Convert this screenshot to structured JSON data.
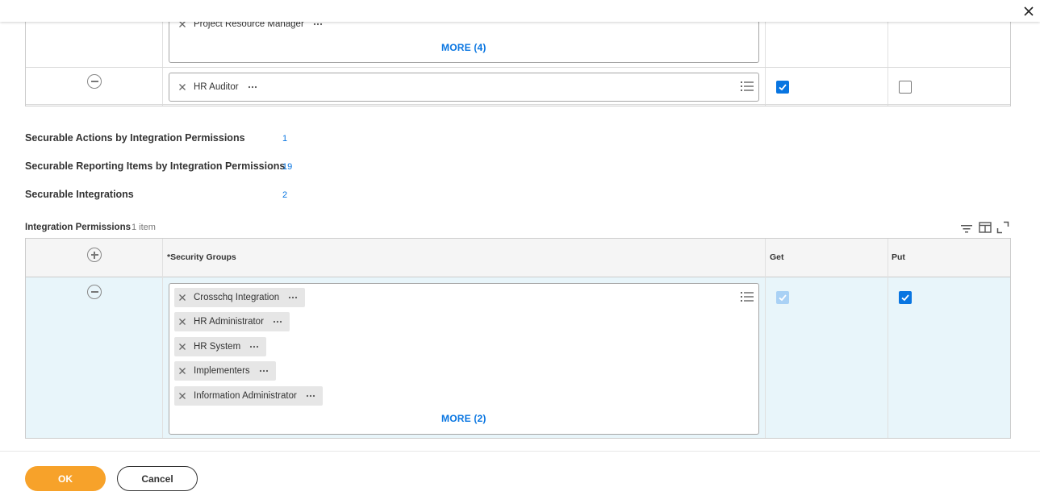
{
  "top_table": {
    "row1": {
      "pill": "Project Resource Manager",
      "more": "MORE (4)"
    },
    "row2": {
      "pill": "HR Auditor",
      "get_checked": true,
      "put_checked": false
    }
  },
  "fields": [
    {
      "label": "Securable Actions by Integration Permissions",
      "value": "1"
    },
    {
      "label": "Securable Reporting Items by Integration Permissions",
      "value": "19"
    },
    {
      "label": "Securable Integrations",
      "value": "2"
    }
  ],
  "integration_permissions": {
    "title": "Integration Permissions",
    "count": "1 item",
    "headers": {
      "security_groups": "*Security Groups",
      "get": "Get",
      "put": "Put"
    },
    "row": {
      "pills": [
        "Crosschq Integration",
        "HR Administrator",
        "HR System",
        "Implementers",
        "Information Administrator"
      ],
      "more": "MORE (2)",
      "get_checked": true,
      "get_disabled": true,
      "put_checked": true
    }
  },
  "footer": {
    "ok": "OK",
    "cancel": "Cancel"
  },
  "colors": {
    "accent": "#0875e1",
    "primary_button": "#f7a22a",
    "selected_row": "#e8f5fa"
  },
  "icons": [
    "close-icon",
    "remove-row-icon",
    "add-row-icon",
    "prompt-list-icon",
    "filter-icon",
    "column-layout-icon",
    "expand-icon",
    "more-options-icon",
    "checkmark-icon"
  ]
}
